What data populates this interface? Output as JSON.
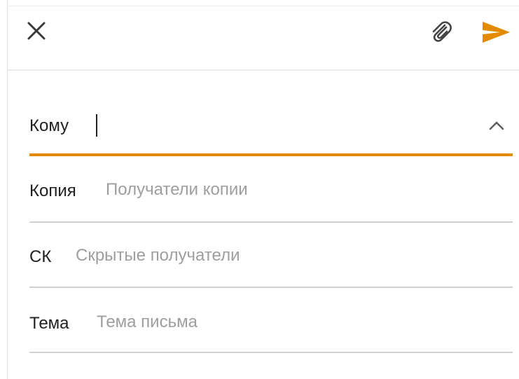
{
  "toolbar": {
    "close_icon": "close-icon",
    "attach_icon": "paperclip-icon",
    "send_icon": "send-icon",
    "accent_color": "#e38a00"
  },
  "compose": {
    "to": {
      "label": "Кому",
      "value": "",
      "expand_icon": "chevron-up-icon"
    },
    "cc": {
      "label": "Копия",
      "placeholder": "Получатели копии"
    },
    "bcc": {
      "label": "СК",
      "placeholder": "Скрытые получатели"
    },
    "subject": {
      "label": "Тема",
      "placeholder": "Тема письма"
    }
  }
}
